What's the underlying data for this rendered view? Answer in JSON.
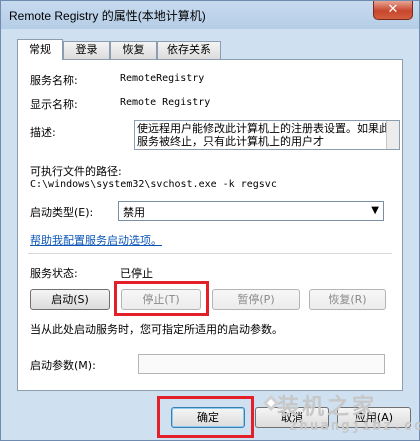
{
  "window": {
    "title": "Remote Registry 的属性(本地计算机)",
    "close_glyph": "✕"
  },
  "tabs": [
    {
      "label": "常规",
      "active": true
    },
    {
      "label": "登录",
      "active": false
    },
    {
      "label": "恢复",
      "active": false
    },
    {
      "label": "依存关系",
      "active": false
    }
  ],
  "general": {
    "service_name_label": "服务名称:",
    "service_name_value": "RemoteRegistry",
    "display_name_label": "显示名称:",
    "display_name_value": "Remote Registry",
    "description_label": "描述:",
    "description_value": "使远程用户能修改此计算机上的注册表设置。如果此服务被终止，只有此计算机上的用户才",
    "path_label": "可执行文件的路径:",
    "path_value": "C:\\windows\\system32\\svchost.exe -k regsvc",
    "startup_type_label": "启动类型(E):",
    "startup_type_value": "禁用",
    "help_link": "帮助我配置服务启动选项。",
    "status_label": "服务状态:",
    "status_value": "已停止",
    "start_button": "启动(S)",
    "stop_button": "停止(T)",
    "pause_button": "暂停(P)",
    "resume_button": "恢复(R)",
    "hint_text": "当从此处启动服务时，您可指定所适用的启动参数。",
    "params_label": "启动参数(M):",
    "params_value": ""
  },
  "footer": {
    "ok_button": "确定",
    "cancel_button": "取消",
    "apply_button": "应用(A)"
  },
  "watermark": {
    "text": "装机之家",
    "url": "zhuangjibz.com"
  },
  "colors": {
    "highlight": "#e3202a",
    "link": "#0b56b8"
  }
}
